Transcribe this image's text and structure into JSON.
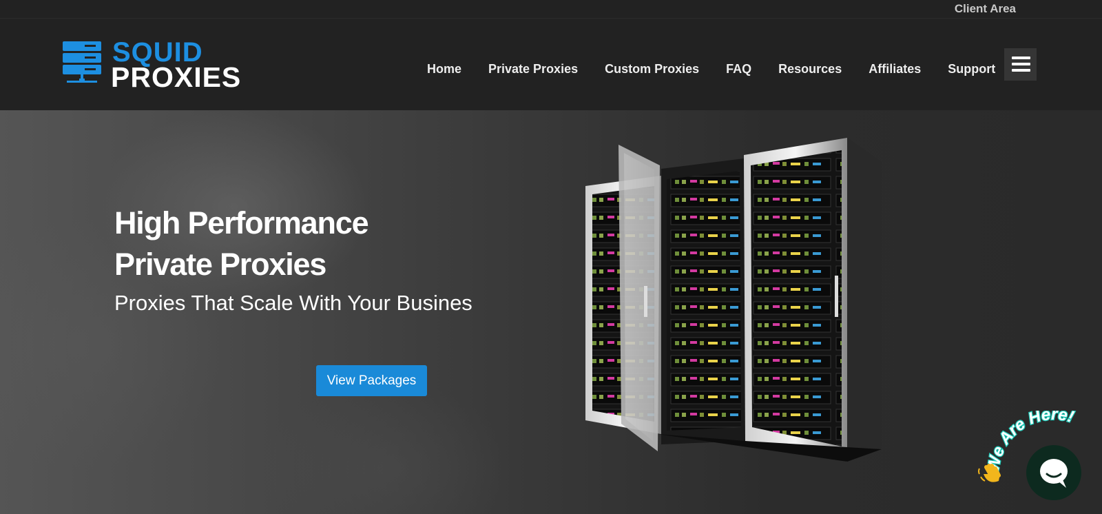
{
  "topbar": {
    "client_area": "Client Area"
  },
  "logo": {
    "line1": "SQUID",
    "line2": "PROXIES"
  },
  "nav": {
    "items": [
      "Home",
      "Private Proxies",
      "Custom Proxies",
      "FAQ",
      "Resources",
      "Affiliates",
      "Support"
    ],
    "menu_icon": "hamburger-menu-icon"
  },
  "hero": {
    "title_line1": "High Performance",
    "title_line2": "Private Proxies",
    "subtitle": "Proxies That Scale With Your Busines",
    "cta_label": "View Packages",
    "image_icon": "server-rack-illustration"
  },
  "chat": {
    "badge_text": "We Are Here!",
    "wave_icon": "waving-hand-icon",
    "bubble_icon": "chat-bubble-icon"
  },
  "colors": {
    "brand_blue": "#1d8fe1",
    "cta_blue": "#1a8ad8",
    "header_bg": "#222222"
  }
}
